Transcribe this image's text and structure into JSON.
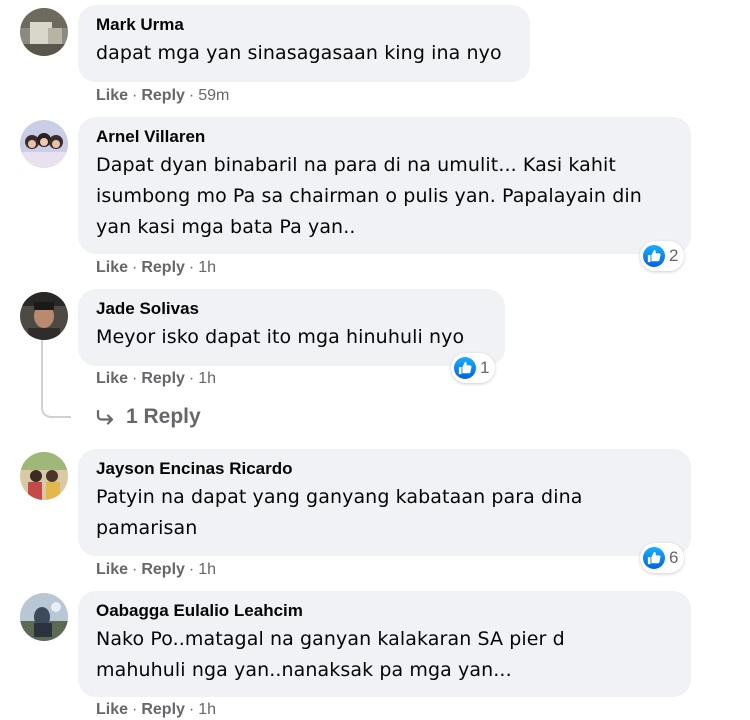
{
  "comments": [
    {
      "author": "Mark Urma",
      "text_lines": [
        "dapat mga yan sinasagasaan king ina nyo"
      ],
      "like_label": "Like",
      "reply_label": "Reply",
      "time": "59m"
    },
    {
      "author": "Arnel Villaren",
      "text_lines": [
        "Dapat dyan binabaril na para di na umulit... Kasi kahit",
        "isumbong mo Pa sa chairman o pulis yan. Papalayain din",
        "yan kasi mga bata Pa yan.."
      ],
      "like_label": "Like",
      "reply_label": "Reply",
      "time": "1h",
      "reaction_count": "2",
      "reaction_icon": "like-icon"
    },
    {
      "author": "Jade Solivas",
      "text_lines": [
        "Meyor isko dapat ito mga hinuhuli nyo"
      ],
      "like_label": "Like",
      "reply_label": "Reply",
      "time": "1h",
      "reaction_count": "1",
      "reaction_icon": "like-icon",
      "replies_label": "1 Reply"
    },
    {
      "author": "Jayson Encinas Ricardo",
      "text_lines": [
        "Patyin na dapat yang ganyang kabataan para dina",
        "pamarisan"
      ],
      "like_label": "Like",
      "reply_label": "Reply",
      "time": "1h",
      "reaction_count": "6",
      "reaction_icon": "like-icon"
    },
    {
      "author": "Oabagga Eulalio Leahcim",
      "text_lines": [
        "Nako Po..matagal na ganyan kalakaran SA pier d",
        "mahuhuli nga yan..nanaksak pa mga yan..."
      ],
      "like_label": "Like",
      "reply_label": "Reply",
      "time": "1h"
    }
  ],
  "separator": "·",
  "colors": {
    "bubble_bg": "#f0f2f5",
    "meta_text": "#65676b",
    "like_blue": "#0f7bf2"
  }
}
